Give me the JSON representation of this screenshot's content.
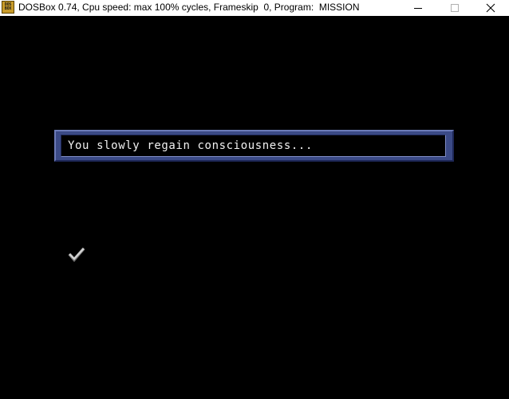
{
  "window": {
    "title": "DOSBox 0.74, Cpu speed: max 100% cycles, Frameskip  0, Program:  MISSION",
    "icon_lines": [
      "DOS",
      "BOX"
    ],
    "controls": {
      "minimize": "minimize-icon",
      "maximize": "maximize-icon",
      "close": "close-icon"
    }
  },
  "game": {
    "message": "You slowly regain consciousness...",
    "cursor": "checkmark-cursor-icon"
  },
  "colors": {
    "background": "#000000",
    "box_fill": "#3b4a86",
    "box_highlight": "#6c7bb8",
    "box_shadow": "#1e2858",
    "text": "#f2f2f2",
    "cursor": "#c8c8c8"
  }
}
